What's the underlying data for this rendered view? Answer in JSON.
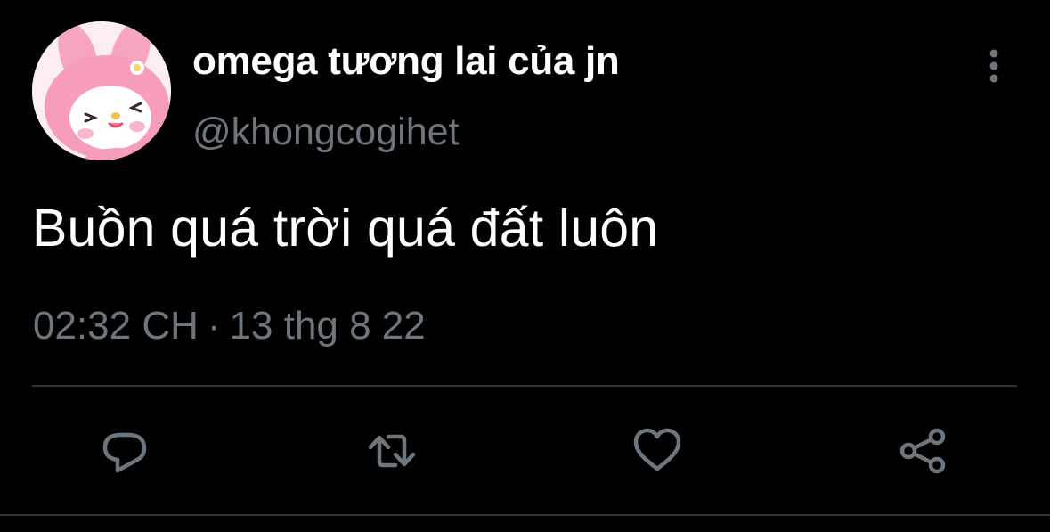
{
  "tweet": {
    "display_name": "omega tương lai của jn",
    "handle": "@khongcogihet",
    "text": "Buồn quá trời quá đất luôn",
    "time": "02:32 CH",
    "separator": "·",
    "date": "13 thg 8 22"
  },
  "icons": {
    "avatar": "my-melody-avatar",
    "more": "vertical-ellipsis-icon",
    "reply": "reply-bubble-icon",
    "retweet": "retweet-icon",
    "like": "heart-icon",
    "share": "share-icon"
  },
  "colors": {
    "background": "#000000",
    "primary_text": "#ffffff",
    "secondary_text": "#6e767d",
    "icon": "#6e767d",
    "divider": "#2f3336"
  }
}
